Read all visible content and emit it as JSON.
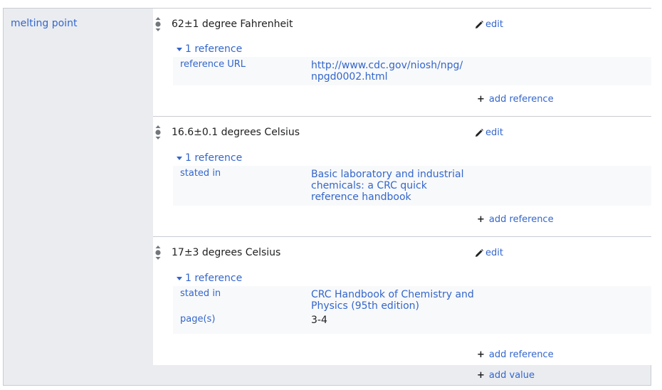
{
  "property": {
    "label": "melting point"
  },
  "statements": [
    {
      "value": "62±1 degree Fahrenheit",
      "edit_label": "edit",
      "references_toggle": "1 reference",
      "reference_snaks": [
        {
          "property": "reference URL",
          "value": "http://www.cdc.gov/niosh/npg/npgd0002.html"
        }
      ],
      "add_reference_label": "add reference"
    },
    {
      "value": "16.6±0.1 degrees Celsius",
      "edit_label": "edit",
      "references_toggle": "1 reference",
      "reference_snaks": [
        {
          "property": "stated in",
          "value": "Basic laboratory and industrial chemicals: a CRC quick reference handbook"
        }
      ],
      "add_reference_label": "add reference"
    },
    {
      "value": "17±3 degrees Celsius",
      "edit_label": "edit",
      "references_toggle": "1 reference",
      "reference_snaks": [
        {
          "property": "stated in",
          "value": "CRC Handbook of Chemistry and Physics (95th edition)"
        },
        {
          "property": "page(s)",
          "value": "3-4"
        }
      ],
      "add_reference_label": "add reference"
    }
  ],
  "add_value_label": "add value",
  "colors": {
    "link": "#3366cc",
    "text": "#202122",
    "group_background": "#eaecf0",
    "reference_background": "#f8f9fa",
    "border": "#c8ccd1"
  },
  "icons": {
    "rank": "rank-normal-icon",
    "edit": "pencil-icon",
    "toggle": "triangle-down-icon",
    "add": "plus-icon"
  }
}
